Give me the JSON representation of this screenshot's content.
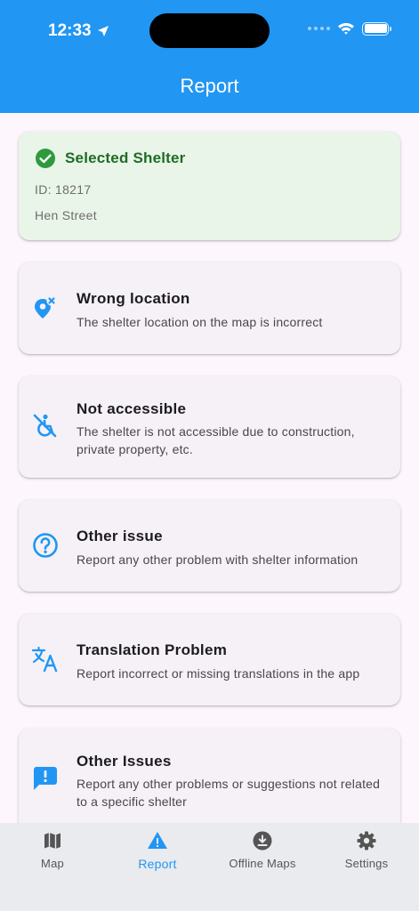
{
  "status_bar": {
    "time": "12:33"
  },
  "app_bar": {
    "title": "Report"
  },
  "selected_shelter": {
    "heading": "Selected Shelter",
    "id_line": "ID: 18217",
    "address": "Hen Street"
  },
  "options": [
    {
      "icon": "wrong-location-icon",
      "title": "Wrong location",
      "description": "The shelter location on the map is incorrect"
    },
    {
      "icon": "not-accessible-icon",
      "title": "Not accessible",
      "description": "The shelter is not accessible due to construction, private property, etc."
    },
    {
      "icon": "help-circle-icon",
      "title": "Other issue",
      "description": "Report any other problem with shelter information"
    },
    {
      "icon": "translate-icon",
      "title": "Translation Problem",
      "description": "Report incorrect or missing translations in the app"
    },
    {
      "icon": "feedback-icon",
      "title": "Other Issues",
      "description": "Report any other problems or suggestions not related to a specific shelter"
    }
  ],
  "nav": [
    {
      "icon": "map-icon",
      "label": "Map"
    },
    {
      "icon": "warning-icon",
      "label": "Report"
    },
    {
      "icon": "download-icon",
      "label": "Offline Maps"
    },
    {
      "icon": "gear-icon",
      "label": "Settings"
    }
  ],
  "colors": {
    "primary": "#2196F3",
    "success": "#1F6B26",
    "success_bg": "#E9F5E8"
  }
}
